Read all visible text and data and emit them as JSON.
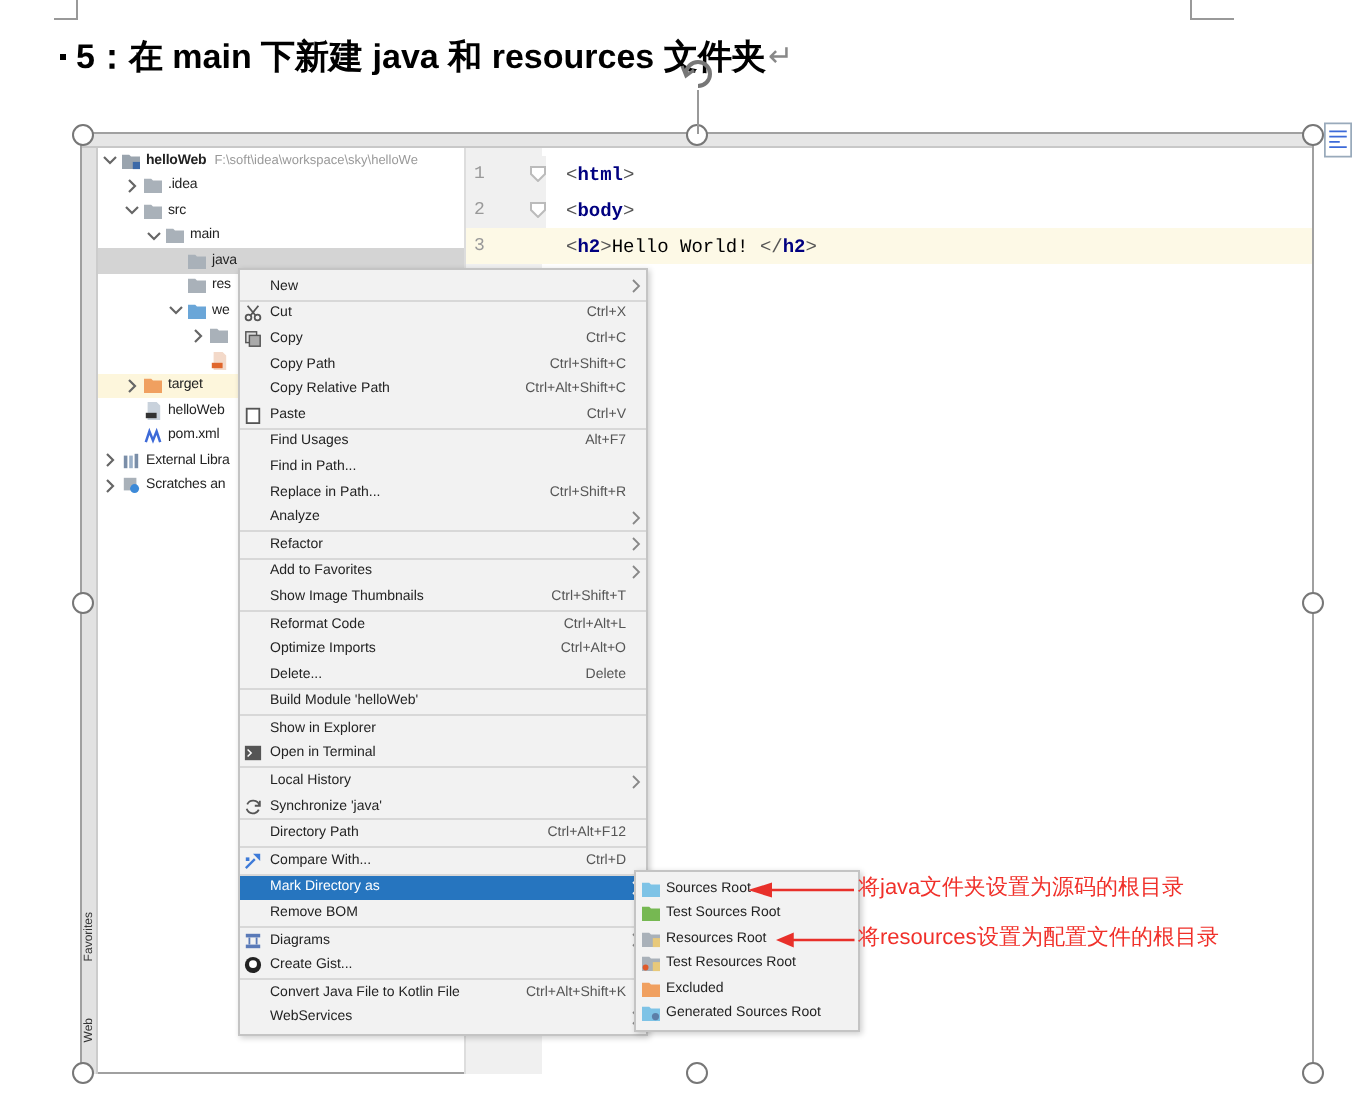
{
  "heading": {
    "text": "5：在 main 下新建 java 和 resources 文件夹",
    "paragraph_mark": "↵"
  },
  "tool_strip": [
    "Favorites",
    "Web"
  ],
  "project_tree": [
    {
      "label": "helloWeb",
      "path": "F:\\soft\\idea\\workspace\\sky\\helloWe",
      "kind": "module",
      "expanded": true,
      "selected": false,
      "children": [
        {
          "label": ".idea",
          "kind": "folder",
          "expanded": false,
          "selected": false
        },
        {
          "label": "src",
          "kind": "folder",
          "expanded": true,
          "selected": false,
          "children": [
            {
              "label": "main",
              "kind": "folder",
              "expanded": true,
              "selected": false,
              "children": [
                {
                  "label": "java",
                  "kind": "folder",
                  "selected": true
                },
                {
                  "label": "res",
                  "kind": "folder",
                  "selected": false
                },
                {
                  "label": "we",
                  "kind": "web",
                  "expanded": true,
                  "selected": false,
                  "children": [
                    {
                      "kind": "folder",
                      "expanded": false,
                      "selected": false
                    },
                    {
                      "kind": "jsp",
                      "selected": false
                    }
                  ]
                }
              ]
            }
          ]
        },
        {
          "label": "target",
          "kind": "excluded",
          "expanded": false,
          "selected": false
        },
        {
          "label": "helloWeb",
          "kind": "iml",
          "selected": false
        },
        {
          "label": "pom.xml",
          "kind": "maven",
          "selected": false
        }
      ]
    },
    {
      "label": "External Libra",
      "kind": "library",
      "expanded": false,
      "selected": false
    },
    {
      "label": "Scratches an",
      "kind": "scratches",
      "expanded": false,
      "selected": false
    }
  ],
  "editor": {
    "lines": [
      {
        "number": "1",
        "fold": true,
        "current": false,
        "tokens": [
          {
            "text": "<",
            "kind": "bracket"
          },
          {
            "text": "html",
            "kind": "tag"
          },
          {
            "text": ">",
            "kind": "bracket"
          }
        ]
      },
      {
        "number": "2",
        "fold": true,
        "current": false,
        "tokens": [
          {
            "text": "<",
            "kind": "bracket"
          },
          {
            "text": "body",
            "kind": "tag"
          },
          {
            "text": ">",
            "kind": "bracket"
          }
        ]
      },
      {
        "number": "3",
        "fold": false,
        "current": true,
        "tokens": [
          {
            "text": "<",
            "kind": "bracket"
          },
          {
            "text": "h2",
            "kind": "tag"
          },
          {
            "text": ">",
            "kind": "bracket"
          },
          {
            "text": "Hello World! ",
            "kind": "text"
          },
          {
            "text": "</",
            "kind": "bracket"
          },
          {
            "text": "h2",
            "kind": "tag"
          },
          {
            "text": ">",
            "kind": "bracket"
          }
        ]
      }
    ]
  },
  "context_menu": {
    "groups": [
      [
        {
          "label": "New",
          "submenu": true,
          "selected": false
        }
      ],
      [
        {
          "label": "Cut",
          "shortcut": "Ctrl+X",
          "kind": "cut",
          "selected": false
        },
        {
          "label": "Copy",
          "shortcut": "Ctrl+C",
          "kind": "copy",
          "selected": false
        },
        {
          "label": "Copy Path",
          "shortcut": "Ctrl+Shift+C",
          "selected": false
        },
        {
          "label": "Copy Relative Path",
          "shortcut": "Ctrl+Alt+Shift+C",
          "selected": false
        },
        {
          "label": "Paste",
          "shortcut": "Ctrl+V",
          "kind": "paste",
          "selected": false
        }
      ],
      [
        {
          "label": "Find Usages",
          "shortcut": "Alt+F7",
          "selected": false
        },
        {
          "label": "Find in Path...",
          "selected": false
        },
        {
          "label": "Replace in Path...",
          "shortcut": "Ctrl+Shift+R",
          "selected": false
        },
        {
          "label": "Analyze",
          "submenu": true,
          "selected": false
        }
      ],
      [
        {
          "label": "Refactor",
          "submenu": true,
          "selected": false
        }
      ],
      [
        {
          "label": "Add to Favorites",
          "submenu": true,
          "selected": false
        },
        {
          "label": "Show Image Thumbnails",
          "shortcut": "Ctrl+Shift+T",
          "selected": false
        }
      ],
      [
        {
          "label": "Reformat Code",
          "shortcut": "Ctrl+Alt+L",
          "selected": false
        },
        {
          "label": "Optimize Imports",
          "shortcut": "Ctrl+Alt+O",
          "selected": false
        },
        {
          "label": "Delete...",
          "shortcut": "Delete",
          "selected": false
        }
      ],
      [
        {
          "label": "Build Module 'helloWeb'",
          "selected": false
        }
      ],
      [
        {
          "label": "Show in Explorer",
          "selected": false
        },
        {
          "label": "Open in Terminal",
          "kind": "terminal",
          "selected": false
        }
      ],
      [
        {
          "label": "Local History",
          "submenu": true,
          "selected": false
        },
        {
          "label": "Synchronize 'java'",
          "kind": "sync",
          "selected": false
        }
      ],
      [
        {
          "label": "Directory Path",
          "shortcut": "Ctrl+Alt+F12",
          "selected": false
        }
      ],
      [
        {
          "label": "Compare With...",
          "shortcut": "Ctrl+D",
          "kind": "compare",
          "selected": false
        }
      ],
      [
        {
          "label": "Mark Directory as",
          "submenu": true,
          "selected": true
        },
        {
          "label": "Remove BOM",
          "selected": false
        }
      ],
      [
        {
          "label": "Diagrams",
          "submenu": true,
          "kind": "diagram",
          "selected": false
        },
        {
          "label": "Create Gist...",
          "kind": "gist",
          "selected": false
        }
      ],
      [
        {
          "label": "Convert Java File to Kotlin File",
          "shortcut": "Ctrl+Alt+Shift+K",
          "selected": false
        },
        {
          "label": "WebServices",
          "submenu": true,
          "selected": false
        }
      ]
    ]
  },
  "submenu": [
    {
      "label": "Sources Root",
      "kind": "sources",
      "selected": false
    },
    {
      "label": "Test Sources Root",
      "kind": "test_sources",
      "selected": false
    },
    {
      "label": "Resources Root",
      "kind": "resources",
      "selected": false
    },
    {
      "label": "Test Resources Root",
      "kind": "test_resources",
      "selected": false
    },
    {
      "label": "Excluded",
      "kind": "excluded",
      "selected": false
    },
    {
      "label": "Generated Sources Root",
      "kind": "generated",
      "selected": false
    }
  ],
  "annotations": [
    {
      "text": "将java文件夹设置为源码的根目录"
    },
    {
      "text": "将resources设置为配置文件的根目录"
    }
  ]
}
